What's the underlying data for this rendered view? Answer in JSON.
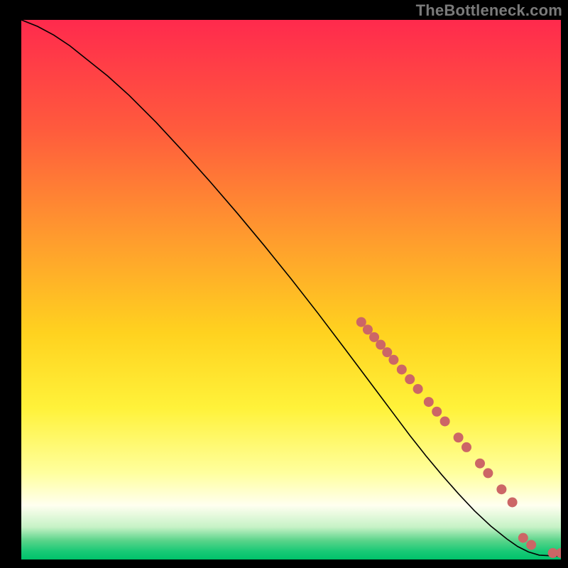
{
  "watermark": "TheBottleneck.com",
  "chart_data": {
    "type": "line",
    "title": "",
    "xlabel": "",
    "ylabel": "",
    "xlim": [
      0,
      100
    ],
    "ylim": [
      0,
      100
    ],
    "grid": false,
    "legend": false,
    "background_gradient": {
      "stops": [
        {
          "offset": 0.0,
          "color": "#ff2a4d"
        },
        {
          "offset": 0.2,
          "color": "#ff5a3d"
        },
        {
          "offset": 0.4,
          "color": "#ff9a2e"
        },
        {
          "offset": 0.58,
          "color": "#ffd21f"
        },
        {
          "offset": 0.72,
          "color": "#fff23a"
        },
        {
          "offset": 0.84,
          "color": "#ffff9e"
        },
        {
          "offset": 0.9,
          "color": "#fffff0"
        },
        {
          "offset": 0.94,
          "color": "#c6f2c6"
        },
        {
          "offset": 0.965,
          "color": "#5ad48a"
        },
        {
          "offset": 0.985,
          "color": "#18c976"
        },
        {
          "offset": 1.0,
          "color": "#00c26b"
        }
      ]
    },
    "series": [
      {
        "name": "bottleneck-curve",
        "color": "#000000",
        "stroke_width": 1.6,
        "x": [
          0,
          3,
          6,
          9,
          12,
          16,
          20,
          25,
          30,
          35,
          40,
          45,
          50,
          55,
          60,
          63,
          66,
          69,
          72,
          75,
          78,
          81,
          84,
          87,
          90,
          92,
          94,
          96,
          100
        ],
        "y": [
          100,
          98.8,
          97.2,
          95.2,
          92.8,
          89.6,
          86.0,
          81.0,
          75.6,
          70.0,
          64.2,
          58.2,
          52.0,
          45.6,
          39.0,
          35.0,
          31.0,
          27.0,
          23.0,
          19.2,
          15.6,
          12.2,
          9.0,
          6.2,
          3.8,
          2.4,
          1.4,
          0.8,
          0.6
        ]
      }
    ],
    "scatter_points": {
      "name": "bottleneck-points",
      "color": "#cc6666",
      "radius": 7,
      "points": [
        {
          "x": 63.0,
          "y": 44.0
        },
        {
          "x": 64.2,
          "y": 42.6
        },
        {
          "x": 65.4,
          "y": 41.2
        },
        {
          "x": 66.6,
          "y": 39.8
        },
        {
          "x": 67.8,
          "y": 38.4
        },
        {
          "x": 69.0,
          "y": 37.0
        },
        {
          "x": 70.5,
          "y": 35.2
        },
        {
          "x": 72.0,
          "y": 33.4
        },
        {
          "x": 73.5,
          "y": 31.6
        },
        {
          "x": 75.5,
          "y": 29.2
        },
        {
          "x": 77.0,
          "y": 27.4
        },
        {
          "x": 78.5,
          "y": 25.6
        },
        {
          "x": 81.0,
          "y": 22.6
        },
        {
          "x": 82.5,
          "y": 20.8
        },
        {
          "x": 85.0,
          "y": 17.8
        },
        {
          "x": 86.5,
          "y": 16.0
        },
        {
          "x": 89.0,
          "y": 13.0
        },
        {
          "x": 91.0,
          "y": 10.6
        },
        {
          "x": 93.0,
          "y": 4.0
        },
        {
          "x": 94.5,
          "y": 2.7
        },
        {
          "x": 98.5,
          "y": 1.2
        },
        {
          "x": 100.0,
          "y": 1.2
        }
      ]
    }
  }
}
